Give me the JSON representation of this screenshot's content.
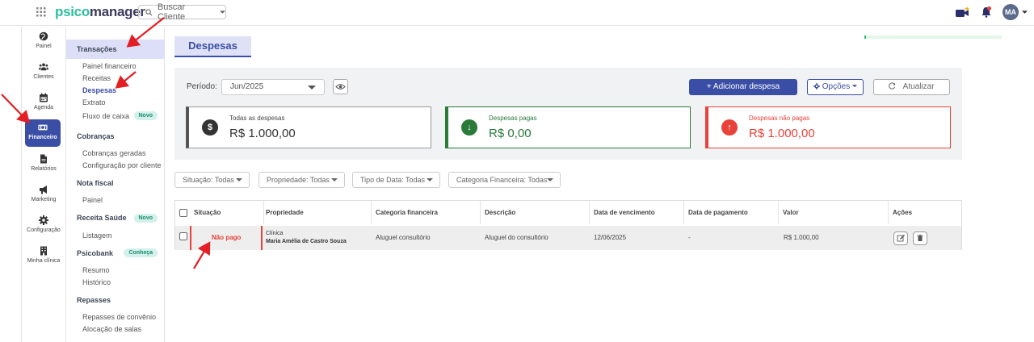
{
  "header": {
    "logo_part1": "psico",
    "logo_part2": "manager",
    "search_placeholder": "Buscar Cliente",
    "avatar_initials": "MA"
  },
  "iconbar": {
    "items": [
      {
        "label": "Painel",
        "icon": "globe-icon"
      },
      {
        "label": "Clientes",
        "icon": "users-icon"
      },
      {
        "label": "Agenda",
        "icon": "calendar-icon"
      },
      {
        "label": "Financeiro",
        "icon": "money-icon"
      },
      {
        "label": "Relatórios",
        "icon": "file-icon"
      },
      {
        "label": "Marketing",
        "icon": "megaphone-icon"
      },
      {
        "label": "Configuração",
        "icon": "gear-icon"
      },
      {
        "label": "Minha clínica",
        "icon": "building-icon"
      }
    ]
  },
  "submenu": {
    "transacoes": "Transações",
    "painel_financeiro": "Painel financeiro",
    "receitas": "Receitas",
    "despesas": "Despesas",
    "extrato": "Extrato",
    "fluxo_caixa": "Fluxo de caixa",
    "novo": "Novo",
    "cobrancas": "Cobranças",
    "cobrancas_geradas": "Cobranças geradas",
    "config_cliente": "Configuração por cliente",
    "nota_fiscal": "Nota fiscal",
    "nf_painel": "Painel",
    "receita_saude": "Receita Saúde",
    "novo2": "Novo",
    "listagem": "Listagem",
    "psicobank": "Psicobank",
    "conheca": "Conheça",
    "resumo": "Resumo",
    "historico": "Histórico",
    "repasses": "Repasses",
    "repasses_convenio": "Repasses de convênio",
    "alocacao_salas": "Alocação de salas"
  },
  "page": {
    "tab_title": "Despesas",
    "progress": 0.01
  },
  "toolbar": {
    "periodo_label": "Período:",
    "periodo_value": "Jun/2025",
    "add_label": "+ Adicionar despesa",
    "options_label": "Opções",
    "update_label": "Atualizar"
  },
  "cards": {
    "total_label": "Todas as despesas",
    "total_value": "R$ 1.000,00",
    "paid_label": "Despesas pagas",
    "paid_value": "R$ 0,00",
    "unpaid_label": "Despesas não pagas",
    "unpaid_value": "R$ 1.000,00"
  },
  "filters": {
    "situacao": "Situação: Todas",
    "propriedade": "Propriedade: Todas",
    "tipo_data": "Tipo de Data: Todas",
    "categoria": "Categoria Financeira: Todas"
  },
  "table": {
    "headers": {
      "situacao": "Situação",
      "propriedade": "Propriedade",
      "categoria": "Categoria financeira",
      "descricao": "Descrição",
      "vencimento": "Data de vencimento",
      "pagamento": "Data de pagamento",
      "valor": "Valor",
      "acoes": "Ações"
    },
    "rows": [
      {
        "situacao": "Não pago",
        "propriedade_tipo": "Clínica",
        "propriedade_nome": "Maria Amélia de Castro Souza",
        "categoria": "Aluguel consultório",
        "descricao": "Aluguel do consultório",
        "vencimento": "12/06/2025",
        "pagamento": "-",
        "valor": "R$ 1.000,00"
      }
    ]
  },
  "colors": {
    "primary": "#3b4ea5",
    "brand_green": "#2bbf9e",
    "paid_green": "#2a7a3a",
    "unpaid_red": "#e8423a",
    "arrow_red": "#e31e24"
  }
}
